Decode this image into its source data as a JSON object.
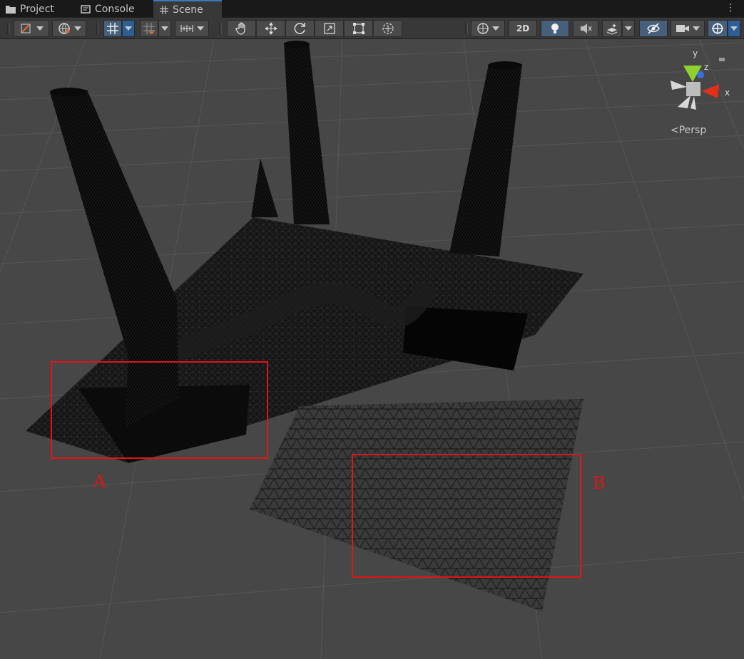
{
  "tabs": [
    {
      "label": "Project",
      "icon": "folder-icon"
    },
    {
      "label": "Console",
      "icon": "console-icon"
    },
    {
      "label": "Scene",
      "icon": "scene-grid-icon",
      "active": true
    }
  ],
  "toolbar": {
    "mode_2d_label": "2D",
    "tools": [
      "hand-tool-icon",
      "move-tool-icon",
      "rotate-tool-icon",
      "scale-tool-icon",
      "rect-tool-icon",
      "transform-tool-icon"
    ]
  },
  "gizmo": {
    "axis_y": "y",
    "axis_z": "z",
    "axis_x": "x",
    "projection_label": "Persp",
    "colors": {
      "x": "#e0301c",
      "y": "#8fd22f",
      "z": "#3a6fe0"
    }
  },
  "annotations": [
    {
      "label": "A",
      "color": "#e01515"
    },
    {
      "label": "B",
      "color": "#e01515"
    }
  ],
  "colors": {
    "accent": "#3a79bb",
    "scene_background": "#474747",
    "annotation_red": "#e01515"
  }
}
